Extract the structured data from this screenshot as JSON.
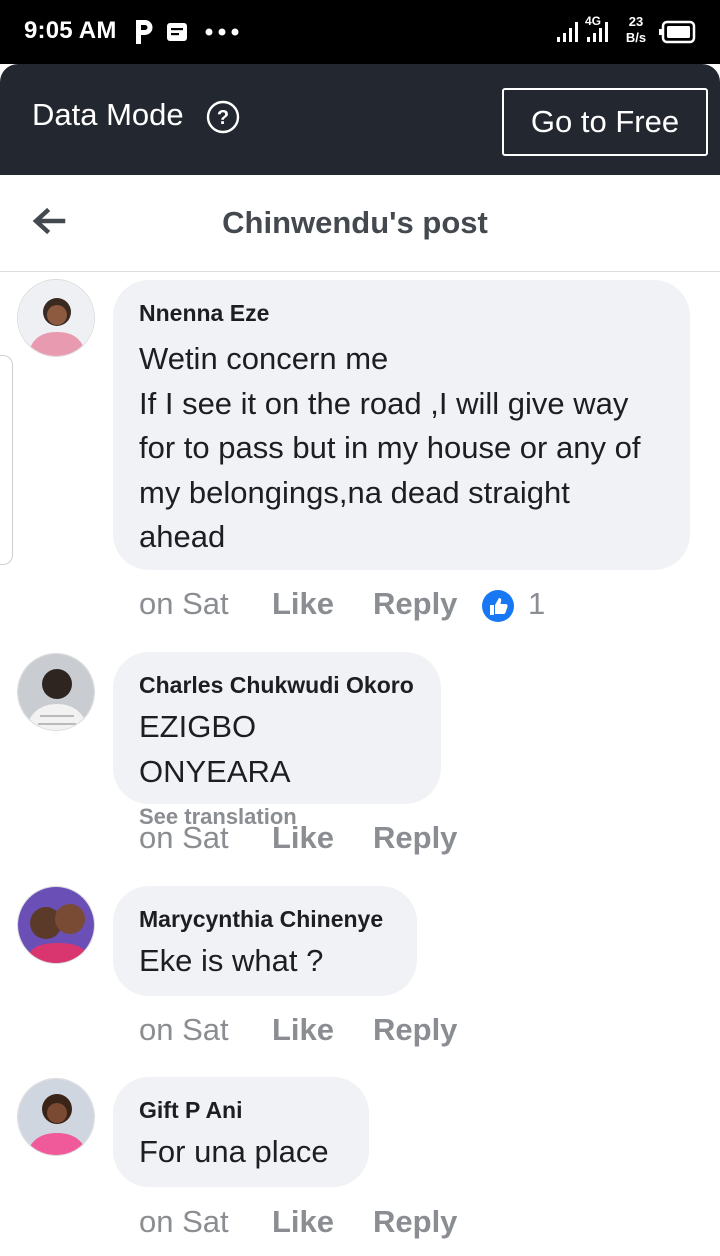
{
  "status_bar": {
    "time": "9:05 AM",
    "network_type": "4G",
    "speed_value": "23",
    "speed_unit": "B/s",
    "icons": [
      "p-icon",
      "message-icon",
      "more-dots-icon",
      "signal-icon",
      "signal-4g-icon",
      "battery-icon"
    ]
  },
  "data_banner": {
    "label": "Data Mode",
    "help_icon": "question-circle-icon",
    "button_label": "Go to Free"
  },
  "header": {
    "back_icon": "arrow-left-icon",
    "title": "Chinwendu's post"
  },
  "comments": [
    {
      "author": "Nnenna Eze",
      "text": "Wetin concern me\nIf I see it on the road ,I will give way for  to pass but in my house or any of my belongings,na dead straight ahead",
      "time": "on Sat",
      "like_label": "Like",
      "reply_label": "Reply",
      "reactions": "1"
    },
    {
      "author": "Charles Chukwudi Okoro",
      "text": "EZIGBO ONYEARA",
      "translate_label": "See translation",
      "time": "on Sat",
      "like_label": "Like",
      "reply_label": "Reply"
    },
    {
      "author": "Marycynthia Chinenye",
      "text": "Eke is what ?",
      "time": "on Sat",
      "like_label": "Like",
      "reply_label": "Reply"
    },
    {
      "author": "Gift P Ani",
      "text": "For una place",
      "time": "on Sat",
      "like_label": "Like",
      "reply_label": "Reply"
    }
  ],
  "colors": {
    "banner_bg": "#232830",
    "bubble_bg": "#f0f2f5",
    "like_blue": "#1877f2",
    "muted_text": "#8a8d91"
  }
}
